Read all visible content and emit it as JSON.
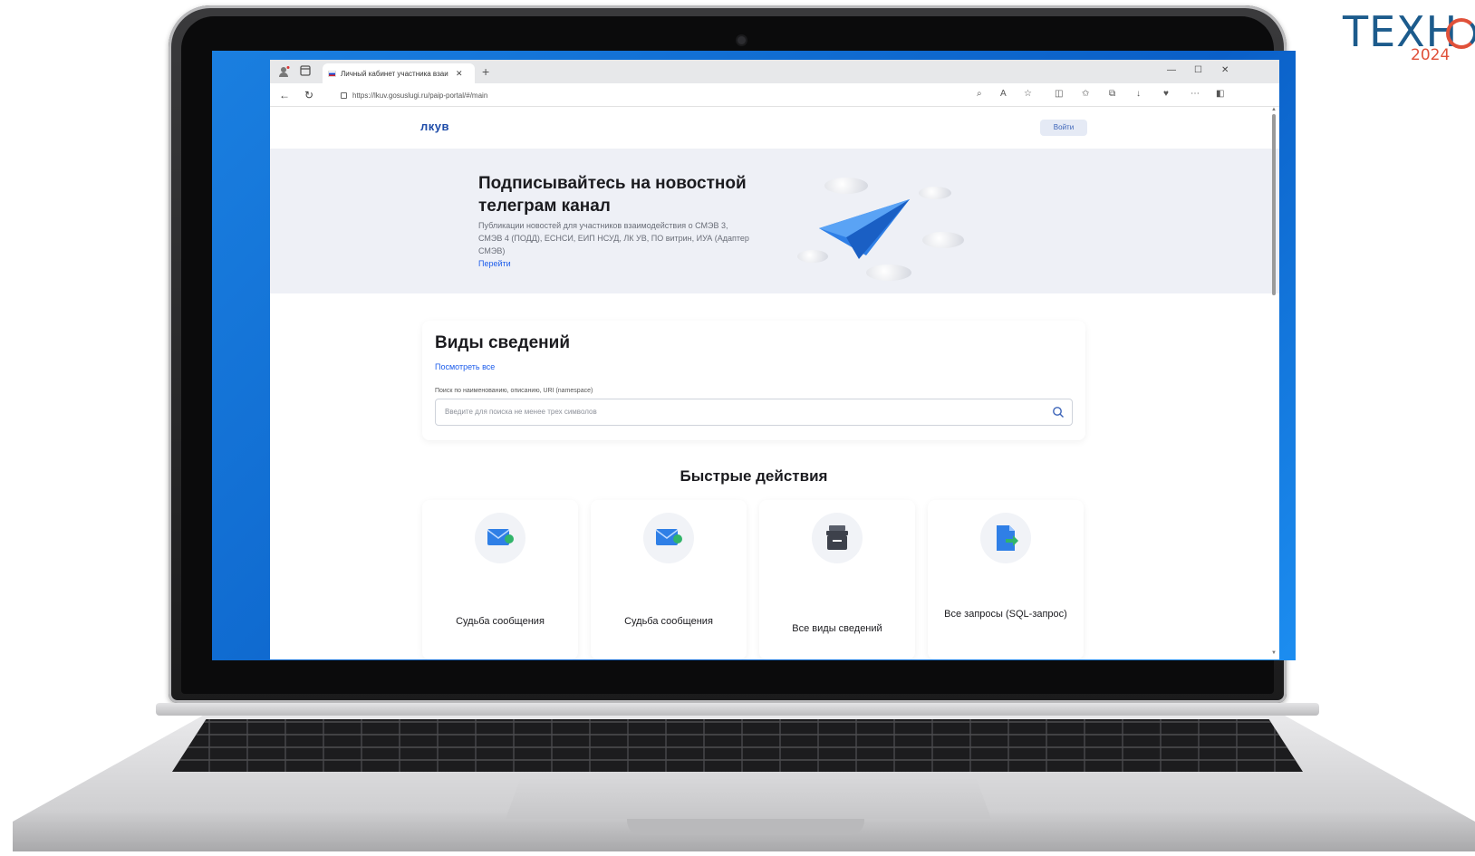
{
  "overlay": {
    "brand": "ТЕХН",
    "year": "2024"
  },
  "browser": {
    "tab": {
      "title": "Личный кабинет участника взаи"
    },
    "url": "https://lkuv.gosuslugi.ru/paip-portal/#/main"
  },
  "site": {
    "logo": "лкув",
    "login_label": "Войти"
  },
  "banner": {
    "title": "Подписывайтесь на новостной телеграм канал",
    "text": "Публикации новостей для участников взаимодействия о СМЭВ 3, СМЭВ 4 (ПОДД), ЕСНСИ, ЕИП НСУД, ЛК УВ, ПО витрин, ИУА (Адаптер СМЭВ)",
    "link": "Перейти"
  },
  "search_card": {
    "title": "Виды сведений",
    "link": "Посмотреть все",
    "label": "Поиск по наименованию, описанию, URI (namespace)",
    "placeholder": "Введите для поиска не менее трех символов"
  },
  "quick_actions": {
    "title": "Быстрые действия",
    "items": [
      {
        "label": "Судьба сообщения",
        "icon": "envelope-icon"
      },
      {
        "label": "Судьба сообщения",
        "icon": "envelope-icon"
      },
      {
        "label": "Все виды сведений",
        "icon": "archive-box-icon"
      },
      {
        "label": "Все запросы (SQL-запрос)",
        "icon": "document-export-icon"
      }
    ]
  },
  "colors": {
    "accent": "#1d5deb",
    "logo": "#1d4ba8",
    "banner_bg": "#eef0f6",
    "plane": "#2f7fe6",
    "desktop": "#0a5fc7"
  }
}
